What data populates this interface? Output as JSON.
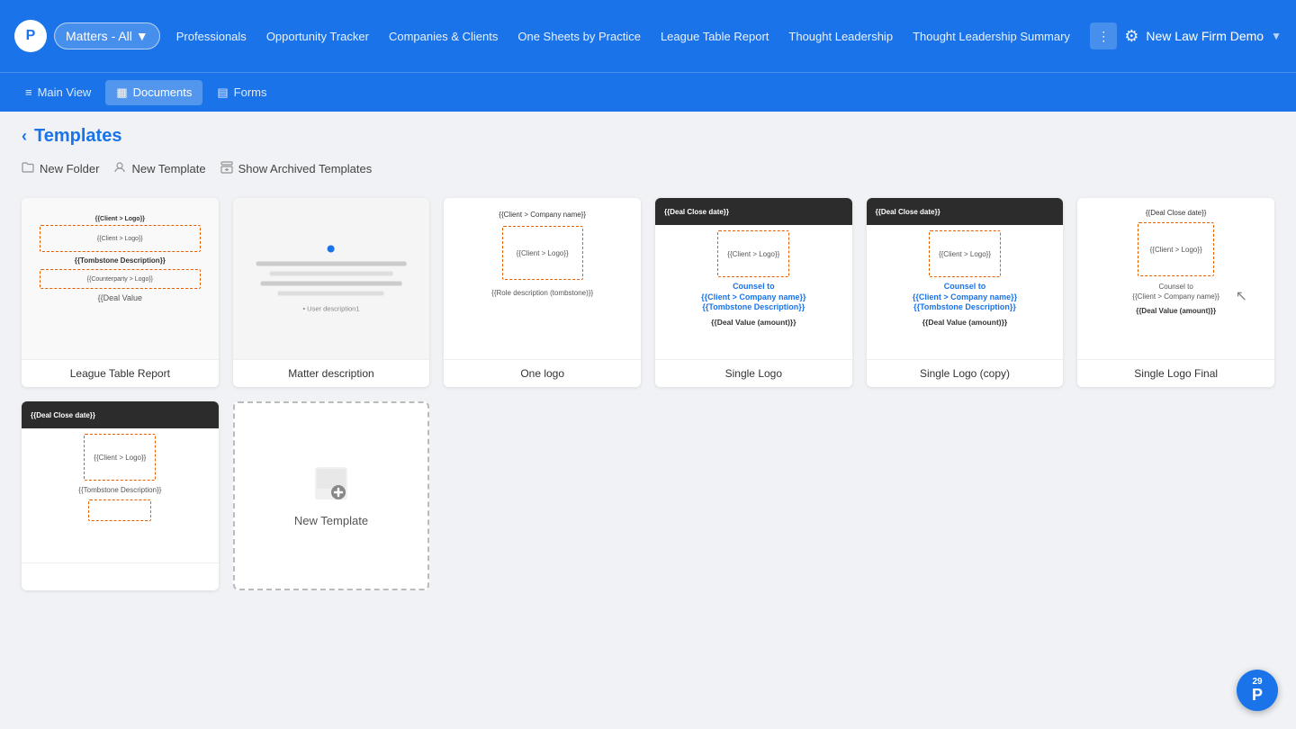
{
  "nav": {
    "logo": "P",
    "matters_label": "Matters - All",
    "links": [
      "Professionals",
      "Opportunity Tracker",
      "Companies & Clients",
      "One Sheets by Practice",
      "League Table Report",
      "Thought Leadership",
      "Thought Leadership Summary"
    ],
    "firm_name": "New Law Firm Demo",
    "settings_label": "Settings"
  },
  "sub_nav": {
    "items": [
      {
        "label": "Main View",
        "icon": "≡",
        "active": false
      },
      {
        "label": "Documents",
        "icon": "▦",
        "active": true
      },
      {
        "label": "Forms",
        "icon": "▤",
        "active": false
      }
    ]
  },
  "page": {
    "breadcrumb_back": "‹",
    "title": "Templates",
    "actions": [
      {
        "id": "new-folder",
        "icon": "📁",
        "label": "New Folder"
      },
      {
        "id": "new-template",
        "icon": "👤",
        "label": "New Template"
      },
      {
        "id": "show-archived",
        "icon": "📋",
        "label": "Show Archived Templates"
      }
    ]
  },
  "templates": [
    {
      "id": "league-table-report",
      "name": "League Table Report",
      "type": "preview",
      "preview_type": "league_table"
    },
    {
      "id": "matter-description",
      "name": "Matter description",
      "type": "preview",
      "preview_type": "matter_desc"
    },
    {
      "id": "one-logo",
      "name": "One logo",
      "type": "preview",
      "preview_type": "one_logo",
      "fields": [
        "{{Client > Company name}}",
        "{{Client > Logo}}",
        "{{Role description (tombstone)}}"
      ]
    },
    {
      "id": "single-logo",
      "name": "Single Logo",
      "type": "preview",
      "preview_type": "single_logo",
      "fields": [
        "{{Deal Close date}}",
        "{{Client > Logo}}",
        "Counsel to",
        "{{Client > Company name}}",
        "{{Tombstone Description}}",
        "{{Deal Value (amount)}}"
      ]
    },
    {
      "id": "single-logo-copy",
      "name": "Single Logo (copy)",
      "type": "preview",
      "preview_type": "single_logo_copy",
      "fields": [
        "{{Deal Close date}}",
        "{{Client > Logo}}",
        "Counsel to",
        "{{Client > Company name}}",
        "{{Tombstone Description}}",
        "{{Deal Value (amount)}}"
      ]
    },
    {
      "id": "single-logo-final",
      "name": "Single Logo Final",
      "type": "preview",
      "preview_type": "single_logo_final",
      "fields": [
        "{{Deal Close date}}",
        "{{Client > Logo}}",
        "Counsel to",
        "{{Client > Company name}}",
        "{{Deal Value (amount)}}"
      ]
    }
  ],
  "second_row_templates": [
    {
      "id": "single-logo-2",
      "name": "",
      "type": "preview",
      "preview_type": "single_logo_dark"
    },
    {
      "id": "new-template-placeholder",
      "name": "New Template",
      "type": "new"
    }
  ],
  "badge": {
    "count": "29",
    "letter": "P"
  }
}
